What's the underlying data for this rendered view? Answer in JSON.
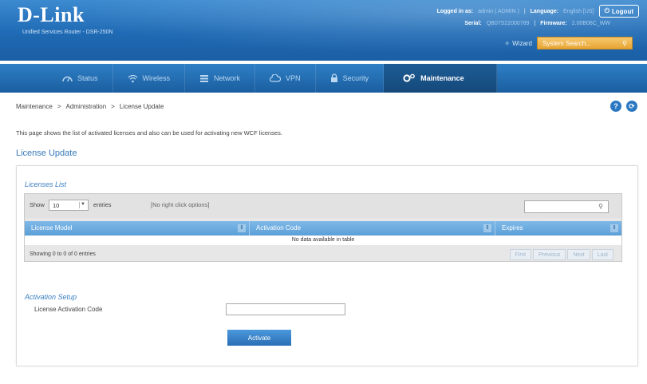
{
  "header": {
    "logo": "D-Link",
    "subtitle": "Unified Services Router - DSR-250N",
    "logged_in_label": "Logged in as:",
    "logged_in_value": "admin ( ADMIN )",
    "language_label": "Language:",
    "language_value": "English [US]",
    "logout_label": "Logout",
    "serial_label": "Serial:",
    "serial_value": "QB07S22000789",
    "firmware_label": "Firmware:",
    "firmware_value": "2.00B06C_WW",
    "wizard_label": "Wizard",
    "search_placeholder": "System Search..."
  },
  "nav": {
    "items": [
      {
        "label": "Status",
        "icon": "dashboard-icon"
      },
      {
        "label": "Wireless",
        "icon": "wifi-icon"
      },
      {
        "label": "Network",
        "icon": "network-icon"
      },
      {
        "label": "VPN",
        "icon": "cloud-icon"
      },
      {
        "label": "Security",
        "icon": "lock-icon"
      },
      {
        "label": "Maintenance",
        "icon": "gears-icon",
        "active": true
      }
    ]
  },
  "breadcrumb": {
    "items": [
      "Maintenance",
      "Administration",
      "License Update"
    ],
    "separator": ">"
  },
  "page": {
    "description": "This page shows the list of activated licenses and also can be used for activating new WCF licenses.",
    "heading": "License Update"
  },
  "licenses_list": {
    "title": "Licenses List",
    "show_label": "Show",
    "show_value": "10",
    "entries_label": "entries",
    "right_click_label": "[No right click options]",
    "columns": [
      "License Model",
      "Activation Code",
      "Expires"
    ],
    "empty_message": "No data available in table",
    "showing_text": "Showing 0 to 0 of 0 entries",
    "pager": [
      "First",
      "Previous",
      "Next",
      "Last"
    ]
  },
  "activation": {
    "title": "Activation Setup",
    "field_label": "License Activation Code",
    "field_value": "",
    "button_label": "Activate"
  },
  "colors": {
    "header_blue": "#1f6ab4",
    "accent_orange": "#e7a433",
    "link_blue": "#3478b8"
  }
}
